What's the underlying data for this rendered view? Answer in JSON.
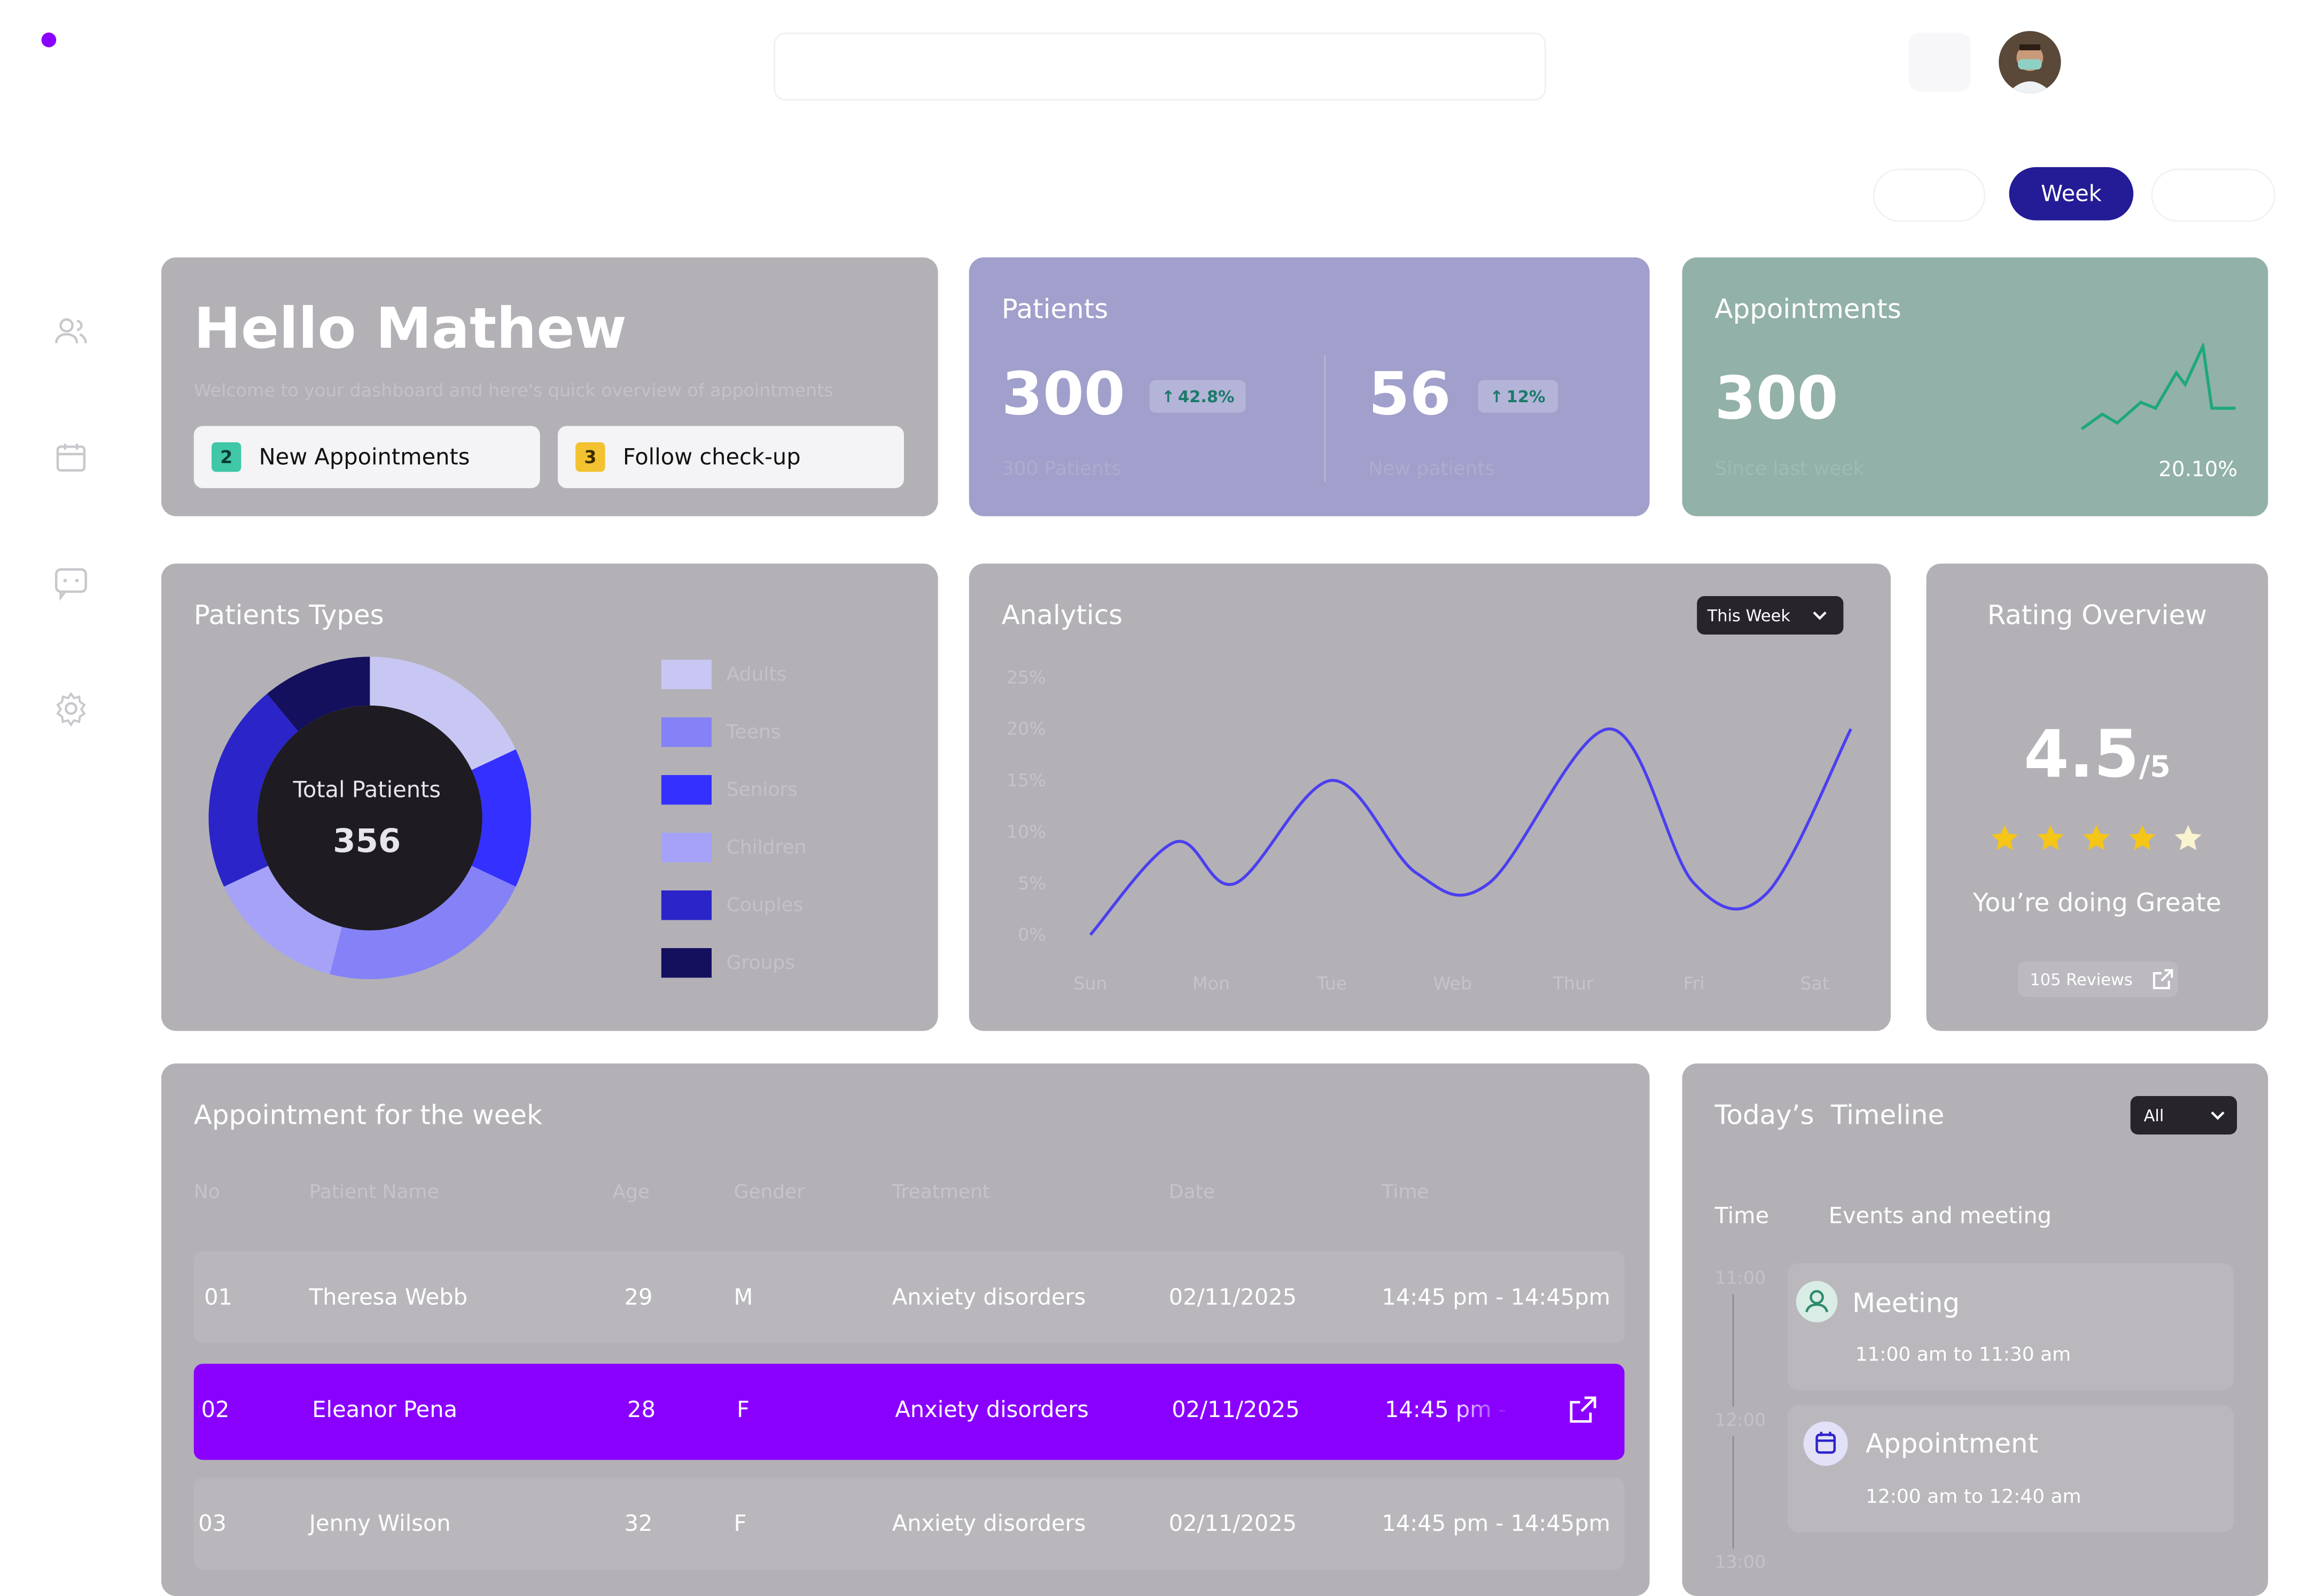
{
  "app": {
    "accent_color": "#8a00ff",
    "logo_dot": "logo-dot"
  },
  "header": {
    "search_placeholder": "",
    "notification_icon": "bell-icon",
    "avatar_label": "user-avatar"
  },
  "period_toggle": {
    "options": [
      "",
      "Week",
      ""
    ],
    "selected": "Week"
  },
  "sidebar": {
    "items": [
      {
        "icon": "users-icon"
      },
      {
        "icon": "calendar-icon"
      },
      {
        "icon": "chat-icon"
      },
      {
        "icon": "settings-icon"
      }
    ]
  },
  "welcome": {
    "title": "Hello Mathew",
    "subtitle": "Welcome to your dashboard and here's quick overview of appointments",
    "chips": [
      {
        "count": "2",
        "label": "New Appointments",
        "color": "#3fc7a8"
      },
      {
        "count": "3",
        "label": "Follow check-up",
        "color": "#f2c230"
      }
    ]
  },
  "patients": {
    "title": "Patients",
    "stats": [
      {
        "value": "300",
        "change": "42.8%",
        "caption": "300 Patients"
      },
      {
        "value": "56",
        "change": "12%",
        "caption": "New patients"
      }
    ]
  },
  "appointments": {
    "title": "Appointments",
    "value": "300",
    "caption": "Since last week",
    "change": "20.10%"
  },
  "patient_types": {
    "title": "Patients Types",
    "center_label": "Total Patients",
    "center_value": "356",
    "legend": [
      {
        "label": "Adults",
        "color": "#c8c7f3"
      },
      {
        "label": "Teens",
        "color": "#8582f7"
      },
      {
        "label": "Seniors",
        "color": "#3430ff"
      },
      {
        "label": "Children",
        "color": "#a5a2f8"
      },
      {
        "label": "Couples",
        "color": "#2a24c9"
      },
      {
        "label": "Groups",
        "color": "#14105e"
      }
    ]
  },
  "analytics": {
    "title": "Analytics",
    "filter": "This Week"
  },
  "rating": {
    "title": "Rating Overview",
    "score": "4.5",
    "out_of": "/5",
    "stars_filled": 4,
    "stars_total": 5,
    "message": "You’re doing Greate",
    "reviews": "105 Reviews"
  },
  "appointments_table": {
    "title": "Appointment for the week",
    "columns": [
      "No",
      "Patient Name",
      "Age",
      "Gender",
      "Treatment",
      "Date",
      "Time"
    ],
    "rows": [
      {
        "no": "01",
        "name": "Theresa Webb",
        "age": "29",
        "gender": "M",
        "treatment": "Anxiety disorders",
        "date": "02/11/2025",
        "time": "14:45 pm - 14:45pm"
      },
      {
        "no": "02",
        "name": "Eleanor Pena",
        "age": "28",
        "gender": "F",
        "treatment": "Anxiety disorders",
        "date": "02/11/2025",
        "time": "14:45 pm - 14:45pm"
      },
      {
        "no": "03",
        "name": "Jenny Wilson",
        "age": "32",
        "gender": "F",
        "treatment": "Anxiety disorders",
        "date": "02/11/2025",
        "time": "14:45 pm - 14:45pm"
      }
    ]
  },
  "timeline": {
    "title": "Today’s  Timeline",
    "filter": "All",
    "col_time": "Time",
    "col_events": "Events and meeting",
    "hours": [
      "11:00",
      "12:00",
      "13:00"
    ],
    "events": [
      {
        "title": "Meeting",
        "time": "11:00 am to 11:30 am",
        "icon": "user-icon"
      },
      {
        "title": "Appointment",
        "time": "12:00 am to 12:40 am",
        "icon": "calendar-icon"
      }
    ]
  },
  "chart_data": [
    {
      "type": "pie",
      "title": "Patients Types",
      "categories": [
        "Adults",
        "Seniors",
        "Teens",
        "Children",
        "Couples",
        "Groups"
      ],
      "values": [
        18,
        14,
        22,
        14,
        21,
        11
      ]
    },
    {
      "type": "line",
      "title": "Analytics",
      "categories": [
        "Sun",
        "Mon",
        "Tue",
        "Web",
        "Thur",
        "Fri",
        "Sat"
      ],
      "y_ticks": [
        "25%",
        "20%",
        "15%",
        "10%",
        "5%",
        "0%"
      ],
      "ylim": [
        0,
        25
      ],
      "series": [
        {
          "x": [
            0,
            0.7,
            1.2,
            2.0,
            2.7,
            3.3,
            4.3,
            5.0,
            5.6,
            6.3
          ],
          "values": [
            0,
            9,
            5,
            15,
            6,
            5,
            20,
            5,
            4,
            20
          ]
        }
      ],
      "grid": false
    }
  ]
}
